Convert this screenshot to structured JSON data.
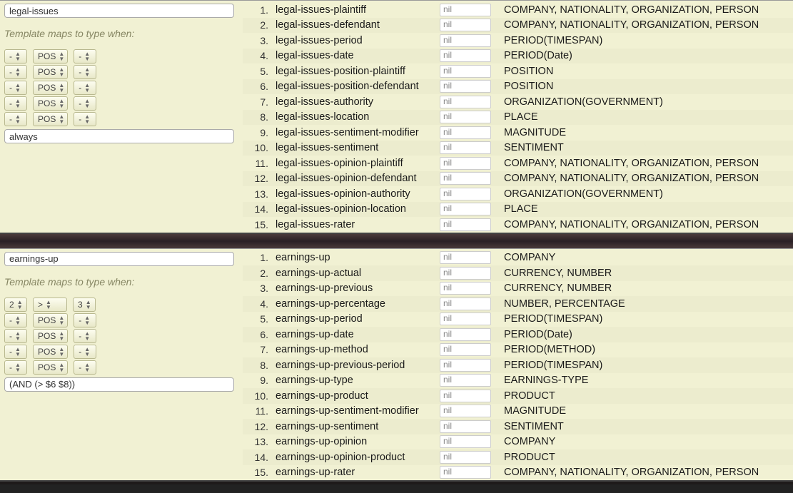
{
  "panels": [
    {
      "name_value": "legal-issues",
      "section_label": "Template maps to type when:",
      "rules": [
        {
          "a": "-",
          "b": "POS",
          "c": "-"
        },
        {
          "a": "-",
          "b": "POS",
          "c": "-"
        },
        {
          "a": "-",
          "b": "POS",
          "c": "-"
        },
        {
          "a": "-",
          "b": "POS",
          "c": "-"
        },
        {
          "a": "-",
          "b": "POS",
          "c": "-"
        }
      ],
      "expr": "always",
      "rows": [
        {
          "n": "1.",
          "name": "legal-issues-plaintiff",
          "nil": "nil",
          "type": "COMPANY, NATIONALITY, ORGANIZATION, PERSON"
        },
        {
          "n": "2.",
          "name": "legal-issues-defendant",
          "nil": "nil",
          "type": "COMPANY, NATIONALITY, ORGANIZATION, PERSON"
        },
        {
          "n": "3.",
          "name": "legal-issues-period",
          "nil": "nil",
          "type": "PERIOD(TIMESPAN)"
        },
        {
          "n": "4.",
          "name": "legal-issues-date",
          "nil": "nil",
          "type": "PERIOD(Date)"
        },
        {
          "n": "5.",
          "name": "legal-issues-position-plaintiff",
          "nil": "nil",
          "type": "POSITION"
        },
        {
          "n": "6.",
          "name": "legal-issues-position-defendant",
          "nil": "nil",
          "type": "POSITION"
        },
        {
          "n": "7.",
          "name": "legal-issues-authority",
          "nil": "nil",
          "type": "ORGANIZATION(GOVERNMENT)"
        },
        {
          "n": "8.",
          "name": "legal-issues-location",
          "nil": "nil",
          "type": "PLACE"
        },
        {
          "n": "9.",
          "name": "legal-issues-sentiment-modifier",
          "nil": "nil",
          "type": "MAGNITUDE"
        },
        {
          "n": "10.",
          "name": "legal-issues-sentiment",
          "nil": "nil",
          "type": "SENTIMENT"
        },
        {
          "n": "11.",
          "name": "legal-issues-opinion-plaintiff",
          "nil": "nil",
          "type": "COMPANY, NATIONALITY, ORGANIZATION, PERSON"
        },
        {
          "n": "12.",
          "name": "legal-issues-opinion-defendant",
          "nil": "nil",
          "type": "COMPANY, NATIONALITY, ORGANIZATION, PERSON"
        },
        {
          "n": "13.",
          "name": "legal-issues-opinion-authority",
          "nil": "nil",
          "type": "ORGANIZATION(GOVERNMENT)"
        },
        {
          "n": "14.",
          "name": "legal-issues-opinion-location",
          "nil": "nil",
          "type": "PLACE"
        },
        {
          "n": "15.",
          "name": "legal-issues-rater",
          "nil": "nil",
          "type": "COMPANY, NATIONALITY, ORGANIZATION, PERSON"
        }
      ]
    },
    {
      "name_value": "earnings-up",
      "section_label": "Template maps to type when:",
      "rules": [
        {
          "a": "2",
          "b": ">",
          "c": "3"
        },
        {
          "a": "-",
          "b": "POS",
          "c": "-"
        },
        {
          "a": "-",
          "b": "POS",
          "c": "-"
        },
        {
          "a": "-",
          "b": "POS",
          "c": "-"
        },
        {
          "a": "-",
          "b": "POS",
          "c": "-"
        }
      ],
      "expr": "(AND (> $6 $8))",
      "rows": [
        {
          "n": "1.",
          "name": "earnings-up",
          "nil": "nil",
          "type": "COMPANY"
        },
        {
          "n": "2.",
          "name": "earnings-up-actual",
          "nil": "nil",
          "type": "CURRENCY, NUMBER"
        },
        {
          "n": "3.",
          "name": "earnings-up-previous",
          "nil": "nil",
          "type": "CURRENCY, NUMBER"
        },
        {
          "n": "4.",
          "name": "earnings-up-percentage",
          "nil": "nil",
          "type": "NUMBER, PERCENTAGE"
        },
        {
          "n": "5.",
          "name": "earnings-up-period",
          "nil": "nil",
          "type": "PERIOD(TIMESPAN)"
        },
        {
          "n": "6.",
          "name": "earnings-up-date",
          "nil": "nil",
          "type": "PERIOD(Date)"
        },
        {
          "n": "7.",
          "name": "earnings-up-method",
          "nil": "nil",
          "type": "PERIOD(METHOD)"
        },
        {
          "n": "8.",
          "name": "earnings-up-previous-period",
          "nil": "nil",
          "type": "PERIOD(TIMESPAN)"
        },
        {
          "n": "9.",
          "name": "earnings-up-type",
          "nil": "nil",
          "type": "EARNINGS-TYPE"
        },
        {
          "n": "10.",
          "name": "earnings-up-product",
          "nil": "nil",
          "type": "PRODUCT"
        },
        {
          "n": "11.",
          "name": "earnings-up-sentiment-modifier",
          "nil": "nil",
          "type": "MAGNITUDE"
        },
        {
          "n": "12.",
          "name": "earnings-up-sentiment",
          "nil": "nil",
          "type": "SENTIMENT"
        },
        {
          "n": "13.",
          "name": "earnings-up-opinion",
          "nil": "nil",
          "type": "COMPANY"
        },
        {
          "n": "14.",
          "name": "earnings-up-opinion-product",
          "nil": "nil",
          "type": "PRODUCT"
        },
        {
          "n": "15.",
          "name": "earnings-up-rater",
          "nil": "nil",
          "type": "COMPANY, NATIONALITY, ORGANIZATION, PERSON"
        }
      ]
    }
  ]
}
